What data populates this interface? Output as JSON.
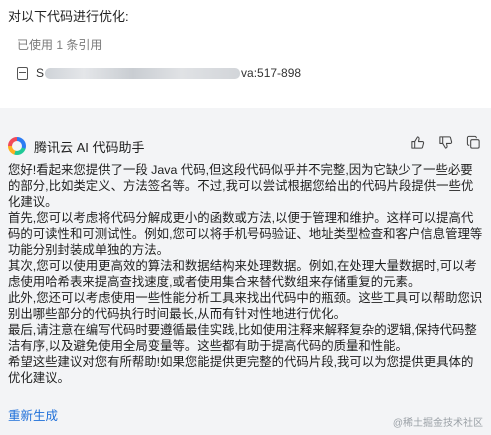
{
  "prompt": {
    "text": "对以下代码进行优化:"
  },
  "reference": {
    "summary": "已使用 1 条引用",
    "item": {
      "prefix": "S",
      "suffix": "va:517-898",
      "icon": "file-icon"
    }
  },
  "assistant": {
    "name": "腾讯云 AI 代码助手",
    "icon": "tencent-cloud-logo",
    "actions": [
      "thumbs-up-icon",
      "thumbs-down-icon",
      "copy-icon"
    ]
  },
  "answer": {
    "paragraphs": [
      "您好!看起来您提供了一段 Java 代码,但这段代码似乎并不完整,因为它缺少了一些必要的部分,比如类定义、方法签名等。不过,我可以尝试根据您给出的代码片段提供一些优化建议。",
      "首先,您可以考虑将代码分解成更小的函数或方法,以便于管理和维护。这样可以提高代码的可读性和可测试性。例如,您可以将手机号码验证、地址类型检查和客户信息管理等功能分别封装成单独的方法。",
      "其次,您可以使用更高效的算法和数据结构来处理数据。例如,在处理大量数据时,可以考虑使用哈希表来提高查找速度,或者使用集合来替代数组来存储重复的元素。",
      "此外,您还可以考虑使用一些性能分析工具来找出代码中的瓶颈。这些工具可以帮助您识别出哪些部分的代码执行时间最长,从而有针对性地进行优化。",
      "最后,请注意在编写代码时要遵循最佳实践,比如使用注释来解释复杂的逻辑,保持代码整洁有序,以及避免使用全局变量等。这些都有助于提高代码的质量和性能。",
      "希望这些建议对您有所帮助!如果您能提供更完整的代码片段,我可以为您提供更具体的优化建议。"
    ]
  },
  "regenerate_label": "重新生成",
  "watermark": "@稀土掘金技术社区",
  "colors": {
    "link": "#1e6fd9",
    "panel_bg": "#f3f4f6",
    "card_bg": "#ffffff"
  }
}
